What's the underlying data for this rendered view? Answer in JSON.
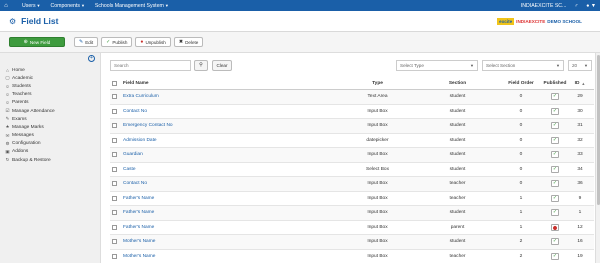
{
  "topbar": {
    "menus": [
      "Users",
      "Components",
      "Schools Management System"
    ],
    "site_name": "INDIAEXCITE SC...",
    "joomla_glyph": "♂",
    "user_glyph": "●"
  },
  "header": {
    "title": "Field List",
    "logo": {
      "part1": "excite",
      "part2": "INDIAEXCITE",
      "part3": "DEMO SCHOOL"
    }
  },
  "toolbar": {
    "new": "New Field",
    "edit": "Edit",
    "publish": "Publish",
    "unpublish": "Unpublish",
    "delete": "Delete"
  },
  "sidebar": {
    "items": [
      {
        "label": "Home",
        "icon": "home-icon",
        "glyph": "⌂"
      },
      {
        "label": "Academic",
        "icon": "academic-icon",
        "glyph": "▢"
      },
      {
        "label": "Students",
        "icon": "students-icon",
        "glyph": "☺"
      },
      {
        "label": "Teachers",
        "icon": "teachers-icon",
        "glyph": "☺"
      },
      {
        "label": "Parents",
        "icon": "parents-icon",
        "glyph": "☺"
      },
      {
        "label": "Manage Attendance",
        "icon": "attendance-icon",
        "glyph": "☑"
      },
      {
        "label": "Exams",
        "icon": "exams-icon",
        "glyph": "✎"
      },
      {
        "label": "Manage Marks",
        "icon": "marks-icon",
        "glyph": "★"
      },
      {
        "label": "Messages",
        "icon": "messages-icon",
        "glyph": "✉"
      },
      {
        "label": "Configuration",
        "icon": "configuration-icon",
        "glyph": "⚙"
      },
      {
        "label": "Addons",
        "icon": "addons-icon",
        "glyph": "▣"
      },
      {
        "label": "Backup & Restore",
        "icon": "backup-icon",
        "glyph": "↻"
      }
    ]
  },
  "filters": {
    "search_placeholder": "Search",
    "clear": "Clear",
    "select_type": "Select Type",
    "select_section": "Select Section",
    "limit": "20"
  },
  "table": {
    "headers": {
      "name": "Field Name",
      "type": "Type",
      "section": "Section",
      "order": "Field Order",
      "published": "Published",
      "id": "ID"
    },
    "rows": [
      {
        "name": "Extra Curriculum",
        "type": "Text Area",
        "section": "student",
        "order": "0",
        "published": true,
        "id": "29"
      },
      {
        "name": "Contact No",
        "type": "Input Box",
        "section": "student",
        "order": "0",
        "published": true,
        "id": "30"
      },
      {
        "name": "Emergency Contact No",
        "type": "Input Box",
        "section": "student",
        "order": "0",
        "published": true,
        "id": "31"
      },
      {
        "name": "Admission Date",
        "type": "datepicker",
        "section": "student",
        "order": "0",
        "published": true,
        "id": "32"
      },
      {
        "name": "Guardian",
        "type": "Input Box",
        "section": "student",
        "order": "0",
        "published": true,
        "id": "33"
      },
      {
        "name": "Caste",
        "type": "Select Box",
        "section": "student",
        "order": "0",
        "published": true,
        "id": "34"
      },
      {
        "name": "Contact No",
        "type": "Input Box",
        "section": "teacher",
        "order": "0",
        "published": true,
        "id": "36"
      },
      {
        "name": "Father's Name",
        "type": "Input Box",
        "section": "teacher",
        "order": "1",
        "published": true,
        "id": "9"
      },
      {
        "name": "Father's Name",
        "type": "Input Box",
        "section": "student",
        "order": "1",
        "published": true,
        "id": "1"
      },
      {
        "name": "Father's Name",
        "type": "Input Box",
        "section": "parent",
        "order": "1",
        "published": false,
        "id": "12"
      },
      {
        "name": "Mother's Name",
        "type": "Input Box",
        "section": "student",
        "order": "2",
        "published": true,
        "id": "16"
      },
      {
        "name": "Mother's Name",
        "type": "Input Box",
        "section": "teacher",
        "order": "2",
        "published": true,
        "id": "19"
      }
    ]
  }
}
